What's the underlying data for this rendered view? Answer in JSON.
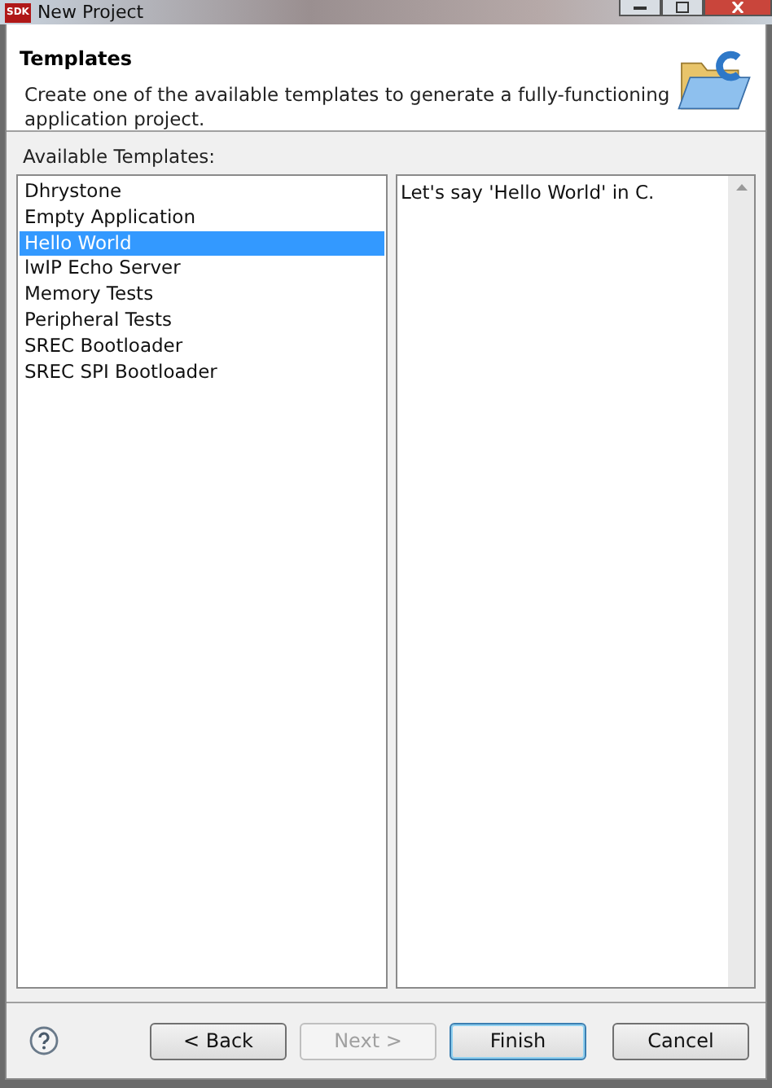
{
  "window": {
    "title": "New Project",
    "app_badge": "SDK"
  },
  "header": {
    "title": "Templates",
    "description": "Create one of the available templates to generate a fully-functioning application project."
  },
  "templates": {
    "label": "Available Templates:",
    "items": [
      {
        "label": "Dhrystone",
        "selected": false
      },
      {
        "label": "Empty Application",
        "selected": false
      },
      {
        "label": "Hello World",
        "selected": true
      },
      {
        "label": "lwIP Echo Server",
        "selected": false
      },
      {
        "label": "Memory Tests",
        "selected": false
      },
      {
        "label": "Peripheral Tests",
        "selected": false
      },
      {
        "label": "SREC Bootloader",
        "selected": false
      },
      {
        "label": "SREC SPI Bootloader",
        "selected": false
      }
    ]
  },
  "description_panel": {
    "text": "Let's say 'Hello World' in C."
  },
  "buttons": [
    {
      "label": "< Back",
      "disabled": false,
      "default": false
    },
    {
      "label": "Next >",
      "disabled": true,
      "default": false
    },
    {
      "label": "Finish",
      "disabled": false,
      "default": true
    },
    {
      "label": "Cancel",
      "disabled": false,
      "default": false
    }
  ]
}
